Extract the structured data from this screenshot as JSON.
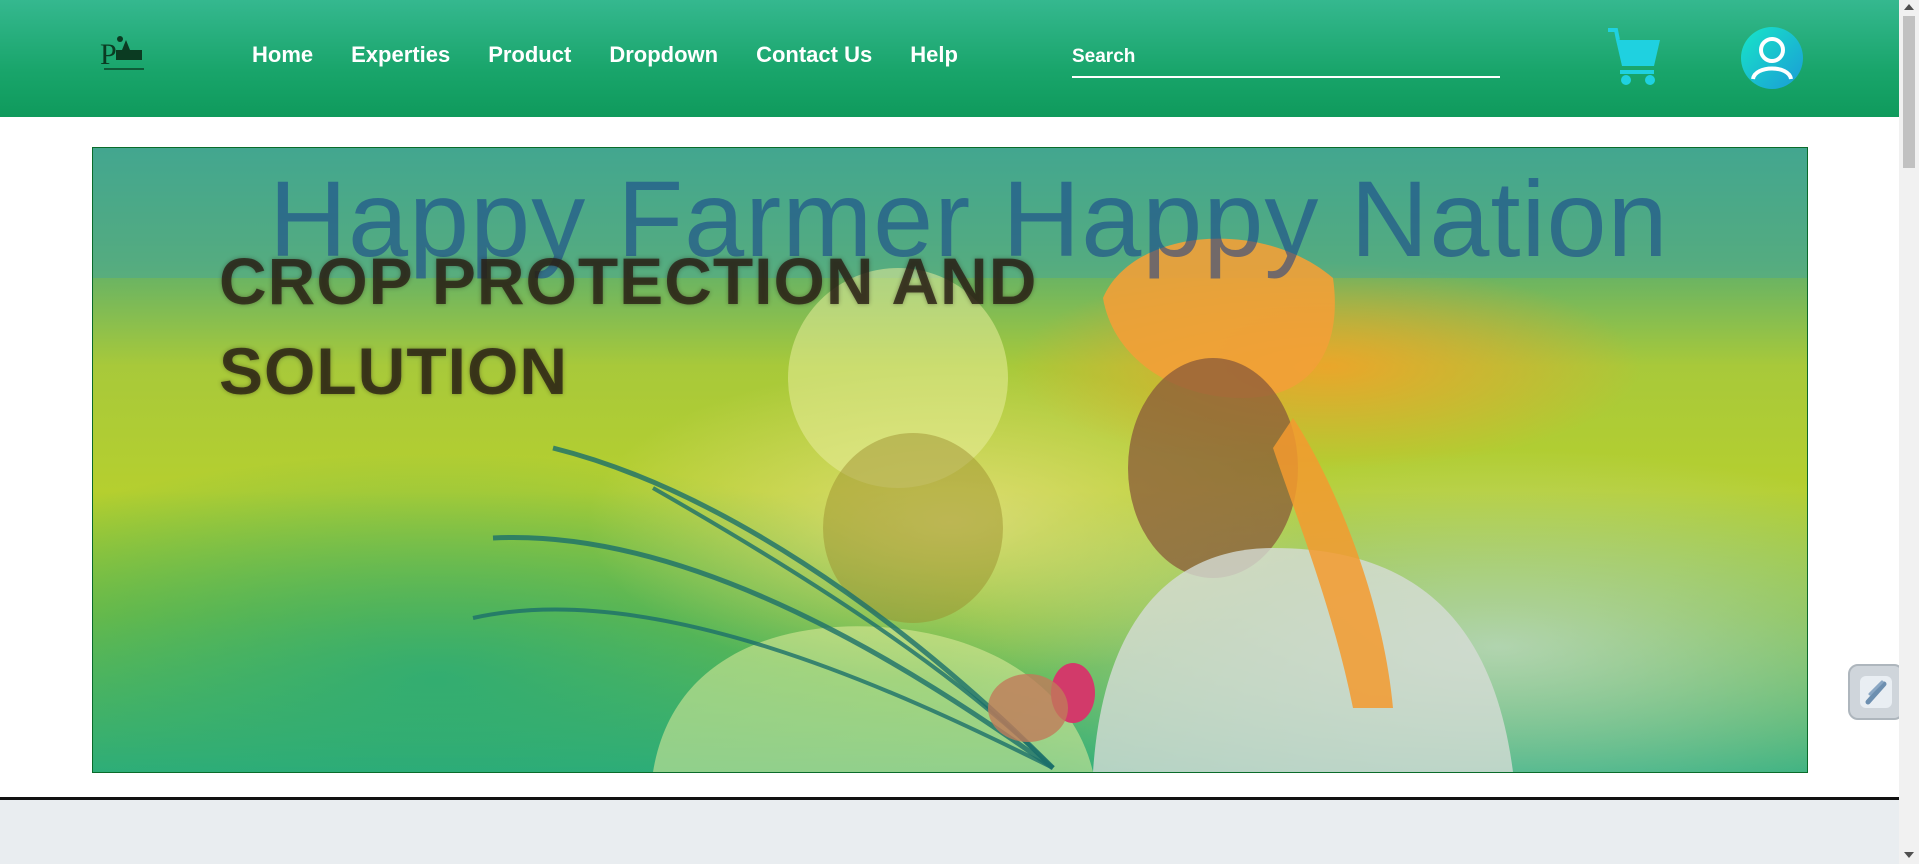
{
  "header": {
    "logo_text": "P",
    "nav_items": [
      {
        "label": "Home"
      },
      {
        "label": "Experties"
      },
      {
        "label": "Product"
      },
      {
        "label": "Dropdown"
      },
      {
        "label": "Contact Us"
      },
      {
        "label": "Help"
      }
    ],
    "search": {
      "placeholder": "Search",
      "value": ""
    },
    "icons": {
      "cart": "shopping-cart-icon",
      "profile": "user-icon"
    },
    "colors": {
      "nav_bg_top": "#35b88f",
      "nav_bg_bottom": "#0f9a5c",
      "cart": "#1fd1e0",
      "avatar": "#18e6c8"
    }
  },
  "hero": {
    "title": "Happy Farmer Happy Nation",
    "subtitle": "CROP PROTECTION AND SOLUTION"
  },
  "widget": {
    "icon": "lightning-icon"
  }
}
